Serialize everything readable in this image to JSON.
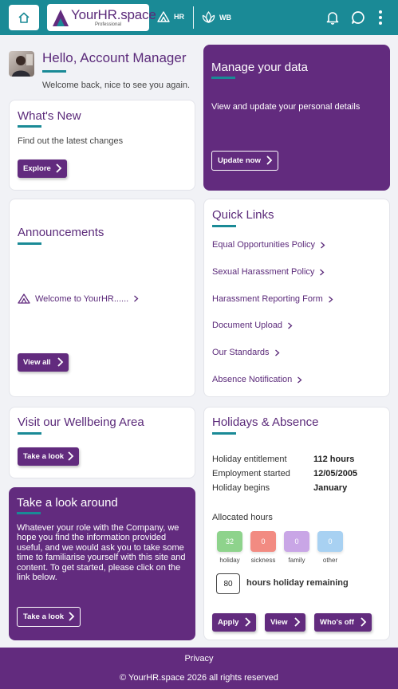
{
  "header": {
    "logo_word": "YourHR.space",
    "logo_sub": "Professional",
    "nav": [
      {
        "label": "HR",
        "icon": "triangle-icon"
      },
      {
        "label": "WB",
        "icon": "lotus-icon"
      }
    ],
    "icons": [
      "home-icon",
      "bell-icon",
      "chat-icon",
      "more-vertical-icon"
    ]
  },
  "greeting": {
    "title": "Hello, Account Manager",
    "subtitle": "Welcome back, nice to see you again."
  },
  "whats_new": {
    "title": "What's New",
    "text": "Find out the latest changes",
    "button": "Explore"
  },
  "manage_data": {
    "title": "Manage your data",
    "text": "View and update your personal details",
    "button": "Update now"
  },
  "announcements": {
    "title": "Announcements",
    "item": "Welcome to YourHR......",
    "button": "View all"
  },
  "quick_links": {
    "title": "Quick Links",
    "items": [
      "Equal Opportunities Policy",
      "Sexual Harassment Policy",
      "Harassment Reporting Form",
      "Document Upload",
      "Our Standards",
      "Absence Notification"
    ]
  },
  "wellbeing": {
    "title": "Visit our Wellbeing Area",
    "button": "Take a look"
  },
  "look_around": {
    "title": "Take a look around",
    "text": "Whatever your role with the Company, we hope you find the information provided useful, and we would ask you to take some time to familiarise yourself with this site and content. To get started, please click on the link below.",
    "button": "Take a look"
  },
  "holidays": {
    "title": "Holidays & Absence",
    "rows": [
      {
        "label": "Holiday entitlement",
        "value": "112 hours"
      },
      {
        "label": "Employment started",
        "value": "12/05/2005"
      },
      {
        "label": "Holiday begins",
        "value": "January"
      }
    ],
    "allocated_label": "Allocated hours",
    "chips": [
      {
        "value": "32",
        "label": "holiday",
        "color": "#8ed38c"
      },
      {
        "value": "0",
        "label": "sickness",
        "color": "#f28b82"
      },
      {
        "value": "0",
        "label": "family",
        "color": "#c9a6e6"
      },
      {
        "value": "0",
        "label": "other",
        "color": "#a8d1f2"
      }
    ],
    "remaining_value": "80",
    "remaining_label": "hours holiday remaining",
    "buttons": [
      "Apply",
      "View",
      "Who's off"
    ]
  },
  "footer": {
    "link": "Privacy",
    "copyright": "© YourHR.space 2026 all rights reserved"
  },
  "colors": {
    "teal": "#1a8a96",
    "purple": "#622b7e",
    "purple_text": "#5b2a7a"
  }
}
